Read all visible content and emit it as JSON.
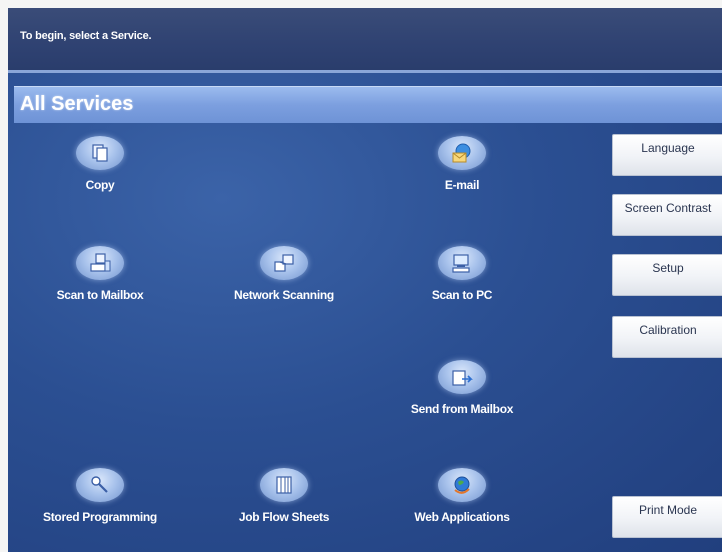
{
  "prompt": "To begin, select a Service.",
  "title": "All Services",
  "services": [
    {
      "label": "Copy",
      "icon": "copy-icon"
    },
    {
      "label": "E-mail",
      "icon": "email-icon"
    },
    {
      "label": "Scan to Mailbox",
      "icon": "scan-to-mailbox-icon"
    },
    {
      "label": "Network Scanning",
      "icon": "network-scanning-icon"
    },
    {
      "label": "Scan to PC",
      "icon": "scan-to-pc-icon"
    },
    {
      "label": "Send from Mailbox",
      "icon": "send-from-mailbox-icon"
    },
    {
      "label": "Stored Programming",
      "icon": "stored-programming-icon"
    },
    {
      "label": "Job Flow Sheets",
      "icon": "job-flow-sheets-icon"
    },
    {
      "label": "Web Applications",
      "icon": "web-applications-icon"
    }
  ],
  "side_buttons": [
    {
      "label": "Language"
    },
    {
      "label": "Screen Contrast"
    },
    {
      "label": "Setup"
    },
    {
      "label": "Calibration"
    },
    {
      "label": "Print Mode"
    }
  ],
  "colors": {
    "screen_background": "#2b4f92",
    "title_bar": "#7c9fdf",
    "prompt_bar": "#2f4272",
    "button_face": "#f1f3f7"
  }
}
